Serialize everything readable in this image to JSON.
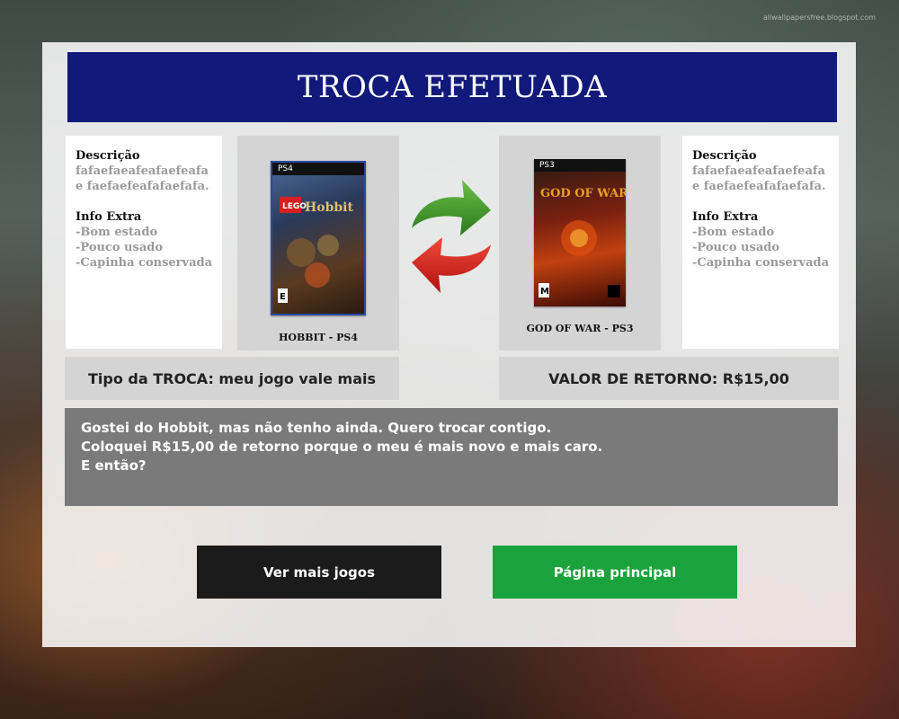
{
  "watermark": "allwallpapersfree.blogspot.com",
  "header": {
    "title": "TROCA EFETUADA"
  },
  "left_info": {
    "desc_label": "Descrição",
    "desc_text": "fafaefaeafeafaefeafae faefaefeafafaefafa.",
    "extra_label": "Info Extra",
    "extra_items": [
      "-Bom estado",
      "-Pouco usado",
      "-Capinha conservada"
    ]
  },
  "right_info": {
    "desc_label": "Descrição",
    "desc_text": "fafaefaeafeafaefeafae faefaefeafafaefafa.",
    "extra_label": "Info Extra",
    "extra_items": [
      "-Bom estado",
      "-Pouco usado",
      "-Capinha conservada"
    ]
  },
  "left_game": {
    "name": "HOBBIT - PS4",
    "platform": "PS4"
  },
  "right_game": {
    "name": "GOD OF WAR - PS3",
    "platform": "PS3"
  },
  "trade_type": "Tipo da TROCA: meu jogo vale mais",
  "return_value": "VALOR DE RETORNO: R$15,00",
  "message": {
    "lines": [
      "Gostei do Hobbit, mas não tenho ainda. Quero trocar contigo.",
      "Coloquei R$15,00 de retorno porque o meu é mais novo e mais caro.",
      "E então?"
    ]
  },
  "buttons": {
    "more_games": "Ver mais jogos",
    "home": "Página principal"
  },
  "colors": {
    "header_bg": "#111a7a",
    "home_button": "#1aa33c",
    "more_button": "#1b1b1b",
    "message_bg": "#7a7a7a",
    "arrow_green": "#3a9a2a",
    "arrow_red": "#d42020"
  },
  "icons": {
    "swap": "swap-arrows-icon"
  }
}
